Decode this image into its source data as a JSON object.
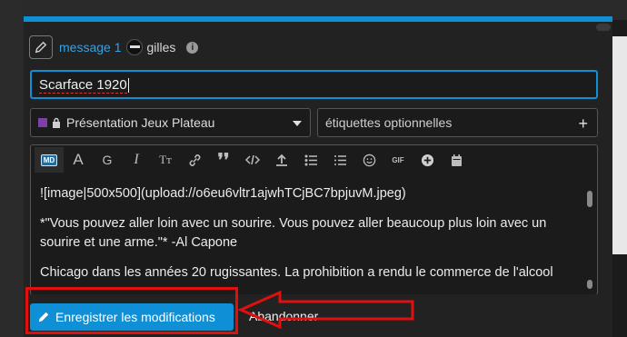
{
  "composer": {
    "message_link": "message 1",
    "username": "gilles",
    "title_value": "Scarface 1920",
    "category": "Présentation Jeux Plateau",
    "tags_placeholder": "étiquettes optionnelles",
    "toolbar_items": [
      "md-toggle",
      "A",
      "G",
      "I",
      "Tт",
      "link",
      "quote",
      "code",
      "upload",
      "list",
      "ordered-list",
      "emoji",
      "GIF",
      "plus",
      "calendar"
    ],
    "editor_lines": [
      "![image|500x500](upload://o6eu6vltr1ajwhTCjBC7bpjuvM.jpeg)",
      "*\"Vous pouvez aller loin avec un sourire. Vous pouvez aller beaucoup plus loin avec un sourire et une arme.\"* -Al Capone",
      "Chicago dans les années 20 rugissantes. La prohibition a rendu le commerce de l'alcool"
    ],
    "save_label": "Enregistrer les modifications",
    "cancel_label": "Abandonner"
  },
  "colors": {
    "accent": "#0e8fd6",
    "category": "#7e3fa8",
    "annotation": "#e01010"
  }
}
